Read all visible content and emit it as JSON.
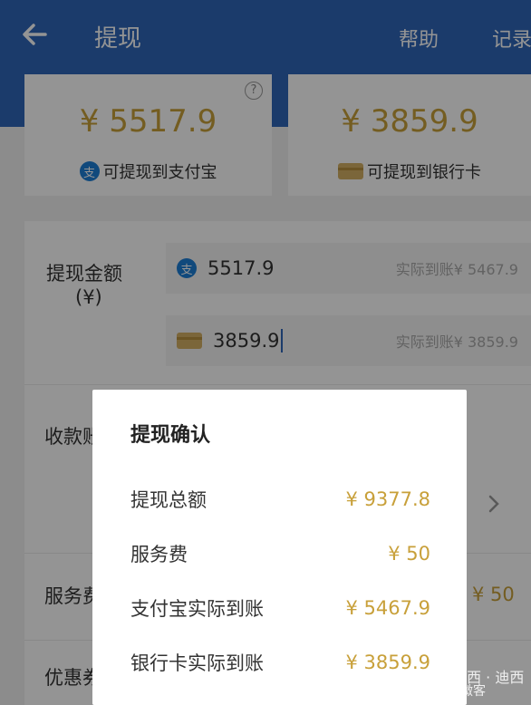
{
  "header": {
    "title": "提现",
    "help": "帮助",
    "records": "记录"
  },
  "cards": {
    "alipay": {
      "amount": "¥ 5517.9",
      "label": "可提现到支付宝",
      "icon": "alipay-icon",
      "icon_char": "支"
    },
    "bank": {
      "amount": "¥ 3859.9",
      "label": "可提现到银行卡",
      "icon": "bank-card-icon"
    },
    "help_char": "?"
  },
  "form": {
    "amount_label": "提现金额",
    "amount_unit": "(¥)",
    "alipay_input": {
      "value": "5517.9",
      "actual": "实际到账¥ 5467.9",
      "icon_char": "支"
    },
    "bank_input": {
      "value": "3859.9",
      "actual": "实际到账¥ 3859.9"
    },
    "payee_label": "收款账",
    "fee_label": "服务费",
    "fee_value": "¥ 50",
    "discount_label": "优惠券"
  },
  "dialog": {
    "title": "提现确认",
    "rows": [
      {
        "label": "提现总额",
        "value": "¥ 9377.8"
      },
      {
        "label": "服务费",
        "value": "¥ 50"
      },
      {
        "label": "支付宝实际到账",
        "value": "¥ 5467.9"
      },
      {
        "label": "银行卡实际到账",
        "value": "¥ 3859.9"
      }
    ]
  },
  "watermark": {
    "line1": "知乎 @迪西 · 迪西",
    "line2": "阿阳微客"
  },
  "colors": {
    "header": "#2f66b8",
    "amount": "#c8a03a",
    "alipay_blue": "#1c7ed6"
  }
}
